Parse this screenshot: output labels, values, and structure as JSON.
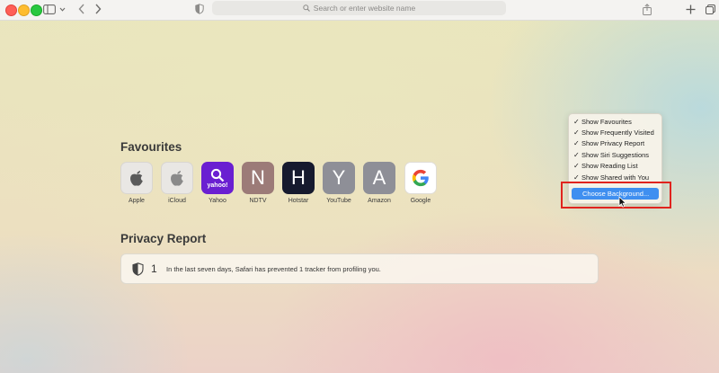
{
  "toolbar": {
    "address_placeholder": "Search or enter website name",
    "icons": [
      "sidebar-icon",
      "chevron-down-icon",
      "back-icon",
      "forward-icon",
      "privacy-shield-icon",
      "search-icon",
      "share-icon",
      "plus-icon",
      "tabs-overview-icon"
    ]
  },
  "favourites": {
    "title": "Favourites",
    "items": [
      {
        "label": "Apple",
        "glyph": "",
        "tile_color": "#e9e7e4",
        "icon": "apple-logo-icon"
      },
      {
        "label": "iCloud",
        "glyph": "",
        "tile_color": "#e9e7e4",
        "icon": "apple-logo-icon"
      },
      {
        "label": "Yahoo",
        "glyph": "yahoo!",
        "tile_color": "#6a1fd1",
        "icon": "yahoo-logo-icon"
      },
      {
        "label": "NDTV",
        "glyph": "N",
        "tile_color": "#9c7b78"
      },
      {
        "label": "Hotstar",
        "glyph": "H",
        "tile_color": "#161a2e"
      },
      {
        "label": "YouTube",
        "glyph": "Y",
        "tile_color": "#8e8f97"
      },
      {
        "label": "Amazon",
        "glyph": "A",
        "tile_color": "#8e8f97"
      },
      {
        "label": "Google",
        "glyph": "G",
        "tile_color": "#ffffff",
        "icon": "google-logo-icon"
      }
    ]
  },
  "privacy": {
    "title": "Privacy Report",
    "count": "1",
    "message": "In the last seven days, Safari has prevented 1 tracker from profiling you."
  },
  "menu": {
    "items": [
      {
        "label": "Show Favourites",
        "checked": true
      },
      {
        "label": "Show Frequently Visited",
        "checked": true
      },
      {
        "label": "Show Privacy Report",
        "checked": true
      },
      {
        "label": "Show Siri Suggestions",
        "checked": true
      },
      {
        "label": "Show Reading List",
        "checked": true
      },
      {
        "label": "Show Shared with You",
        "checked": true
      }
    ],
    "check_glyph": "✓",
    "highlighted": "Choose Background..."
  },
  "colors": {
    "highlight": "#3f8ff0",
    "annotation_red": "#e0231e"
  }
}
